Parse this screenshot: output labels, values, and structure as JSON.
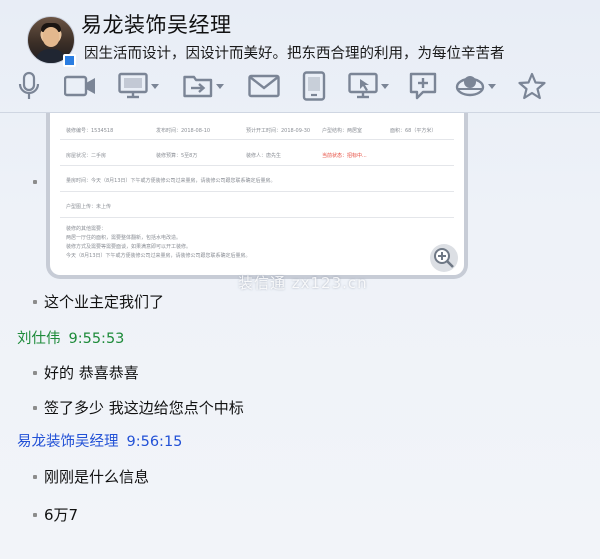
{
  "header": {
    "contact_name": "易龙装饰吴经理",
    "signature": "因生活而设计，因设计而美好。把东西合理的利用，为每位辛苦者",
    "toolbar_icons": [
      "microphone-icon",
      "video-call-icon",
      "screen-share-icon",
      "file-transfer-icon",
      "email-icon",
      "phone-device-icon",
      "remote-desktop-icon",
      "add-app-icon",
      "group-icon",
      "favorite-star-icon"
    ]
  },
  "image_message": {
    "doc": {
      "row1": [
        "装修编号：1534518",
        "发布时间：2018-08-10",
        "预计开工时间：2018-09-30",
        "户型结构：两居室",
        "面积：68（平方米）"
      ],
      "row2": [
        "房屋状况：二手房",
        "装修预算：5至8万",
        "装修人：唐先生",
        "当前状态：招标中..."
      ],
      "row3": "量房时间：今天（8月13日）下午或方便装修公司过来量房，请装修公司跟您联系确定后量房。",
      "row4": "户型图上传：未上传",
      "notes": [
        "装修的其他需要：",
        "两居一厅住的面积，需要整体翻新，包括水电改造。",
        "装修方式及需要等需要面谈，如果满意即可以开工装修。",
        "今天（8月13日）下午或方便装修公司过来量房，请装修公司跟您联系确定后量房。"
      ]
    },
    "watermark": "装信通 zx123.cn"
  },
  "messages": [
    {
      "type": "text",
      "text": "这个业主定我们了"
    },
    {
      "type": "sender",
      "name": "刘仕伟",
      "time": "9:55:53"
    },
    {
      "type": "text",
      "text": "好的 恭喜恭喜"
    },
    {
      "type": "text",
      "text": "签了多少 我这边给您点个中标"
    },
    {
      "type": "sender",
      "name": "易龙装饰吴经理",
      "time": "9:56:15"
    },
    {
      "type": "text",
      "text": "刚刚是什么信息"
    },
    {
      "type": "text",
      "text": "6万7"
    }
  ],
  "colors": {
    "sender_other": "#1e8b3a",
    "sender_self": "#2251d6"
  }
}
